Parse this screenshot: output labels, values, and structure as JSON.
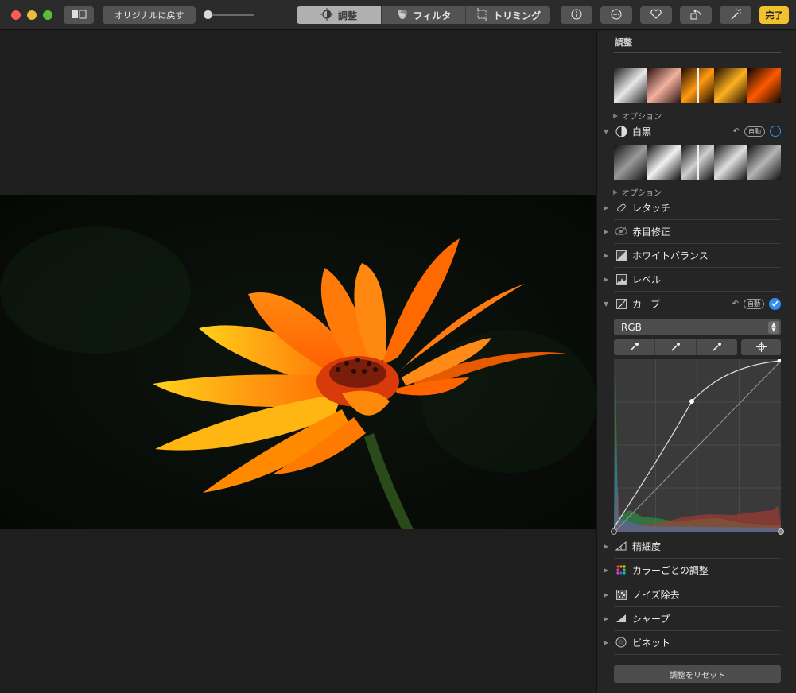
{
  "toolbar": {
    "revert_label": "オリジナルに戻す",
    "tabs": [
      {
        "label": "調整",
        "active": true
      },
      {
        "label": "フィルタ",
        "active": false
      },
      {
        "label": "トリミング",
        "active": false
      }
    ],
    "done_label": "完了",
    "icons": [
      "info-icon",
      "more-icon",
      "heart-icon",
      "rotate-icon",
      "magic-wand-icon"
    ]
  },
  "sidebar": {
    "title": "調整",
    "light_options": "オプション",
    "bw": {
      "label": "白黒",
      "auto": "自動",
      "options": "オプション"
    },
    "items": {
      "retouch": "レタッチ",
      "redeye": "赤目修正",
      "whitebalance": "ホワイトバランス",
      "levels": "レベル",
      "curves": "カーブ",
      "definition": "精細度",
      "selective_color": "カラーごとの調整",
      "noise": "ノイズ除去",
      "sharpen": "シャープ",
      "vignette": "ビネット"
    },
    "curves_auto": "自動",
    "channel_value": "RGB",
    "reset_label": "調整をリセット"
  },
  "colors": {
    "accent_blue": "#2f8cf0",
    "done_yellow": "#f2c12e"
  }
}
